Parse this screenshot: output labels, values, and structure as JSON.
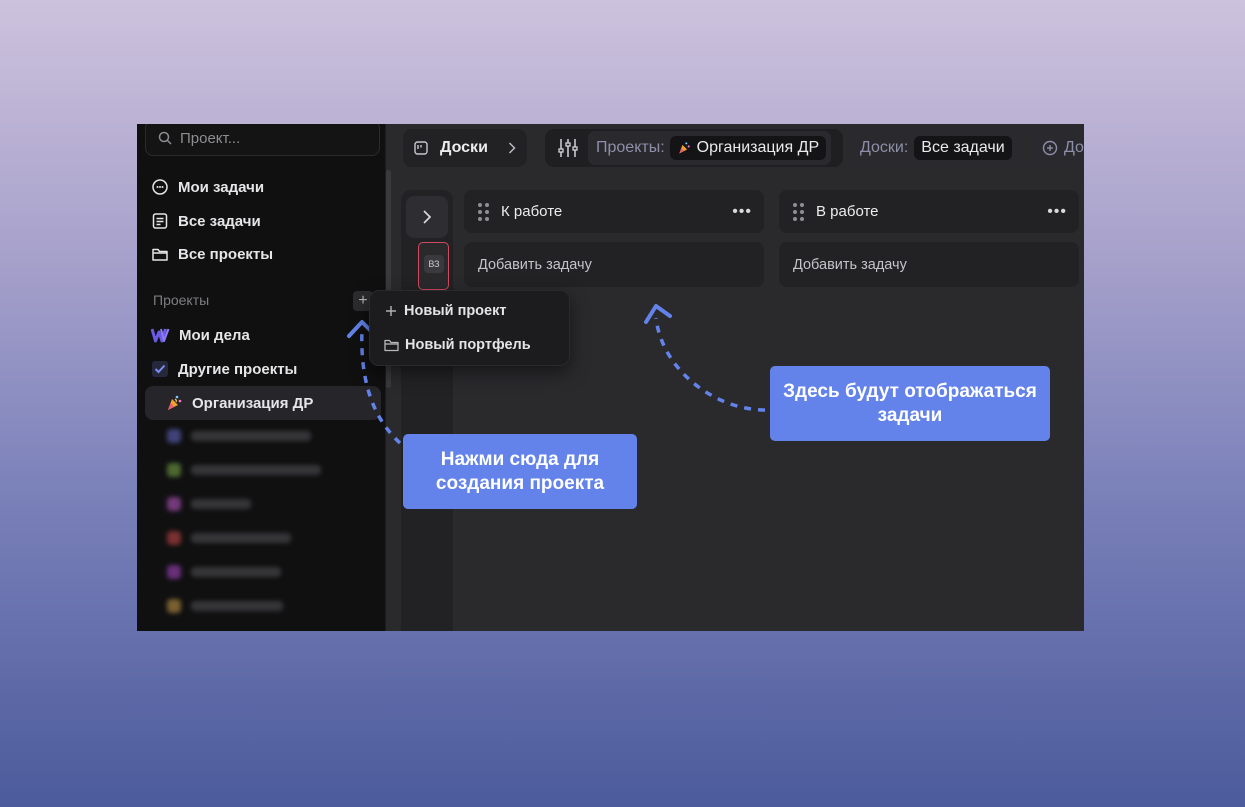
{
  "sidebar": {
    "search_placeholder": "Проект...",
    "nav": [
      {
        "label": "Мои задачи",
        "icon": "my-tasks-icon"
      },
      {
        "label": "Все задачи",
        "icon": "all-tasks-icon"
      },
      {
        "label": "Все проекты",
        "icon": "folder-icon"
      }
    ],
    "projects_label": "Проекты",
    "add_symbol": "+",
    "projects": [
      {
        "label": "Мои дела",
        "icon": "workspace-logo-icon"
      },
      {
        "label": "Другие проекты",
        "icon": "checkbox-icon"
      },
      {
        "label": "Организация ДР",
        "icon": "party-icon"
      }
    ]
  },
  "dropdown": {
    "items": [
      {
        "label": "Новый проект",
        "icon": "plus-icon"
      },
      {
        "label": "Новый портфель",
        "icon": "folder-icon"
      }
    ]
  },
  "topbar": {
    "boards_button": "Доски",
    "projects_label": "Проекты:",
    "projects_value": "Организация ДР",
    "boards_label": "Доски:",
    "boards_value": "Все задачи",
    "add_label": "До"
  },
  "board": {
    "avatar_initials": "ВЗ",
    "columns": [
      {
        "title": "К работе",
        "add_task": "Добавить задачу"
      },
      {
        "title": "В работе",
        "add_task": "Добавить задачу"
      }
    ]
  },
  "callouts": {
    "create_project": "Нажми сюда для создания проекта",
    "tasks_here": "Здесь будут отображаться задачи"
  },
  "colors": {
    "accent": "#6383ea",
    "avatar_border": "#d04a62"
  }
}
